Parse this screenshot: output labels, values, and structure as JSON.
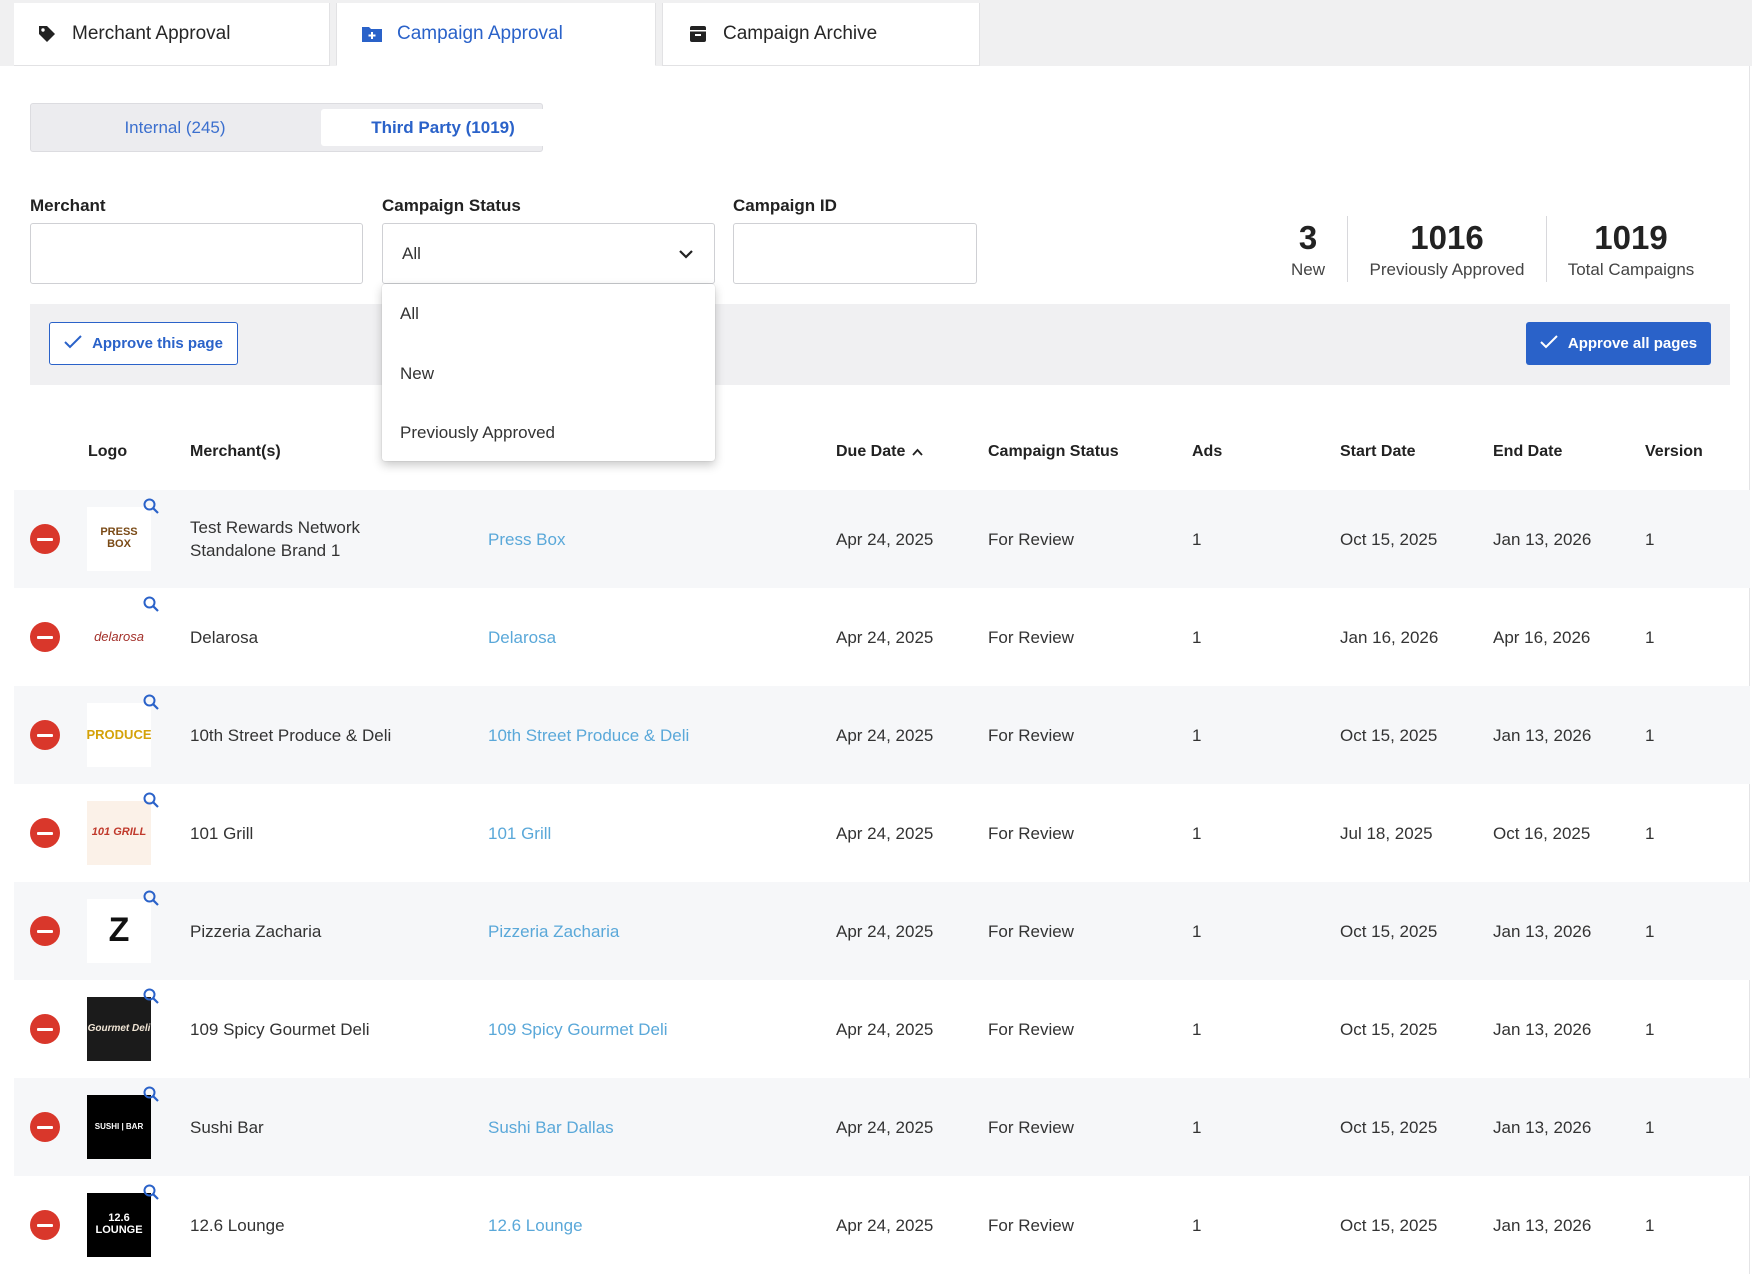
{
  "tabs": [
    {
      "label": "Merchant Approval",
      "icon": "tag-icon",
      "active": false
    },
    {
      "label": "Campaign Approval",
      "icon": "folder-plus-icon",
      "active": true
    },
    {
      "label": "Campaign Archive",
      "icon": "archive-box-icon",
      "active": false
    }
  ],
  "segments": {
    "internal": "Internal (245)",
    "third_party": "Third Party (1019)",
    "selected": "third_party"
  },
  "filters": {
    "merchant_label": "Merchant",
    "merchant_value": "",
    "status_label": "Campaign Status",
    "status_value": "All",
    "campaign_id_label": "Campaign ID",
    "campaign_id_value": ""
  },
  "status_menu": {
    "options": [
      "All",
      "New",
      "Previously Approved"
    ]
  },
  "stats": {
    "new_count": "3",
    "new_label": "New",
    "prev_count": "1016",
    "prev_label": "Previously Approved",
    "total_count": "1019",
    "total_label": "Total Campaigns"
  },
  "actions": {
    "approve_page": "Approve this page",
    "approve_all": "Approve all pages"
  },
  "colors": {
    "accent": "#2a62c9",
    "link": "#5aa8d9",
    "remove": "#d9372b",
    "row_shade": "#f6f7f9"
  },
  "table": {
    "headers": {
      "logo": "Logo",
      "merchants": "Merchant(s)",
      "due_date": "Due Date",
      "campaign_status": "Campaign Status",
      "ads": "Ads",
      "start_date": "Start Date",
      "end_date": "End Date",
      "version": "Version"
    },
    "sort": {
      "column": "due_date",
      "direction": "ascending"
    },
    "rows": [
      {
        "merchant": "Test Rewards Network Standalone Brand 1",
        "campaign": "Press Box",
        "due_date": "Apr 24, 2025",
        "status": "For Review",
        "ads": "1",
        "start_date": "Oct 15, 2025",
        "end_date": "Jan 13, 2026",
        "version": "1",
        "logo_text": "PRESS BOX"
      },
      {
        "merchant": "Delarosa",
        "campaign": "Delarosa",
        "due_date": "Apr 24, 2025",
        "status": "For Review",
        "ads": "1",
        "start_date": "Jan 16, 2026",
        "end_date": "Apr 16, 2026",
        "version": "1",
        "logo_text": "delarosa"
      },
      {
        "merchant": "10th Street Produce & Deli",
        "campaign": "10th Street Produce & Deli",
        "due_date": "Apr 24, 2025",
        "status": "For Review",
        "ads": "1",
        "start_date": "Oct 15, 2025",
        "end_date": "Jan 13, 2026",
        "version": "1",
        "logo_text": "PRODUCE"
      },
      {
        "merchant": "101 Grill",
        "campaign": "101 Grill",
        "due_date": "Apr 24, 2025",
        "status": "For Review",
        "ads": "1",
        "start_date": "Jul 18, 2025",
        "end_date": "Oct 16, 2025",
        "version": "1",
        "logo_text": "101 GRILL"
      },
      {
        "merchant": "Pizzeria Zacharia",
        "campaign": "Pizzeria Zacharia",
        "due_date": "Apr 24, 2025",
        "status": "For Review",
        "ads": "1",
        "start_date": "Oct 15, 2025",
        "end_date": "Jan 13, 2026",
        "version": "1",
        "logo_text": "Z"
      },
      {
        "merchant": "109 Spicy Gourmet Deli",
        "campaign": "109 Spicy Gourmet Deli",
        "due_date": "Apr 24, 2025",
        "status": "For Review",
        "ads": "1",
        "start_date": "Oct 15, 2025",
        "end_date": "Jan 13, 2026",
        "version": "1",
        "logo_text": "Gourmet Deli"
      },
      {
        "merchant": "Sushi Bar",
        "campaign": "Sushi Bar Dallas",
        "due_date": "Apr 24, 2025",
        "status": "For Review",
        "ads": "1",
        "start_date": "Oct 15, 2025",
        "end_date": "Jan 13, 2026",
        "version": "1",
        "logo_text": "SUSHI | BAR"
      },
      {
        "merchant": "12.6 Lounge",
        "campaign": "12.6 Lounge",
        "due_date": "Apr 24, 2025",
        "status": "For Review",
        "ads": "1",
        "start_date": "Oct 15, 2025",
        "end_date": "Jan 13, 2026",
        "version": "1",
        "logo_text": "12.6 LOUNGE"
      }
    ]
  }
}
